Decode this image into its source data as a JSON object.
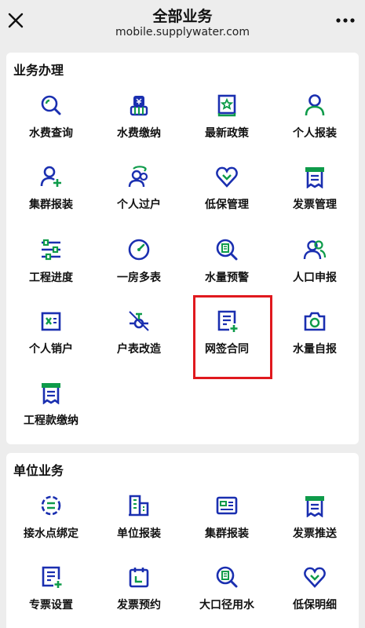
{
  "header": {
    "title": "全部业务",
    "subtitle": "mobile.supplywater.com"
  },
  "section1": {
    "title": "业务办理",
    "items": [
      {
        "label": "水费查询",
        "icon": "search-icon"
      },
      {
        "label": "水费缴纳",
        "icon": "payment-icon"
      },
      {
        "label": "最新政策",
        "icon": "policy-book-icon"
      },
      {
        "label": "个人报装",
        "icon": "person-icon"
      },
      {
        "label": "集群报装",
        "icon": "group-add-icon"
      },
      {
        "label": "个人过户",
        "icon": "transfer-user-icon"
      },
      {
        "label": "低保管理",
        "icon": "heart-icon"
      },
      {
        "label": "发票管理",
        "icon": "invoice-icon"
      },
      {
        "label": "工程进度",
        "icon": "sliders-icon"
      },
      {
        "label": "一房多表",
        "icon": "gauge-icon"
      },
      {
        "label": "水量预警",
        "icon": "water-warning-icon"
      },
      {
        "label": "人口申报",
        "icon": "people-icon"
      },
      {
        "label": "个人销户",
        "icon": "close-account-icon"
      },
      {
        "label": "户表改造",
        "icon": "valve-icon"
      },
      {
        "label": "网签合同",
        "icon": "contract-add-icon"
      },
      {
        "label": "水量自报",
        "icon": "camera-icon"
      },
      {
        "label": "工程款缴纳",
        "icon": "receipt-icon"
      }
    ]
  },
  "section2": {
    "title": "单位业务",
    "items": [
      {
        "label": "接水点绑定",
        "icon": "link-point-icon"
      },
      {
        "label": "单位报装",
        "icon": "building-icon"
      },
      {
        "label": "集群报装",
        "icon": "id-card-icon"
      },
      {
        "label": "发票推送",
        "icon": "invoice-icon"
      },
      {
        "label": "专票设置",
        "icon": "special-invoice-icon"
      },
      {
        "label": "发票预约",
        "icon": "calendar-icon"
      },
      {
        "label": "大口径用水",
        "icon": "water-warning-icon"
      },
      {
        "label": "低保明细",
        "icon": "heart-icon"
      }
    ]
  },
  "colors": {
    "icon_blue": "#1a2fb0",
    "icon_green": "#0e9b4a",
    "highlight": "#e0191e"
  }
}
